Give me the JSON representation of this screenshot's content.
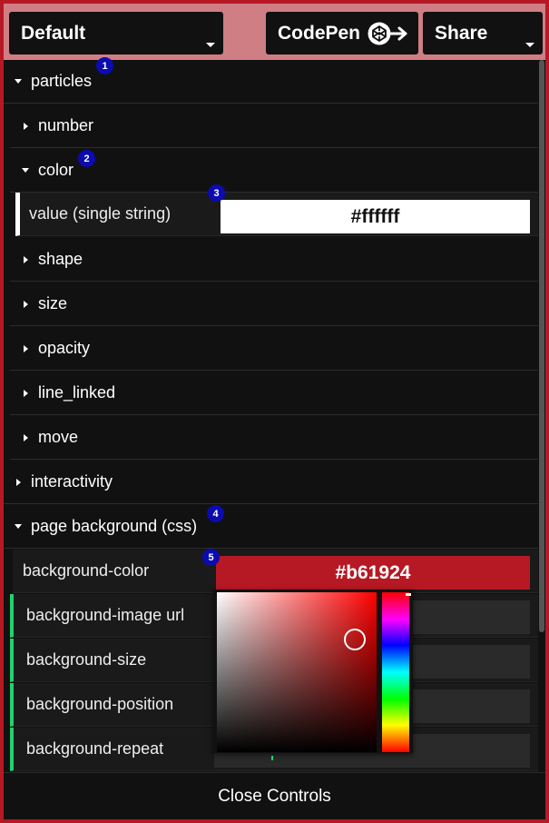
{
  "topbar": {
    "preset": "Default",
    "codepen_label": "CodePen",
    "share_label": "Share"
  },
  "markers": [
    "1",
    "2",
    "3",
    "4",
    "5"
  ],
  "tree": {
    "particles": "particles",
    "number": "number",
    "color": "color",
    "value_label": "value (single string)",
    "value": "#ffffff",
    "shape": "shape",
    "size": "size",
    "opacity": "opacity",
    "line_linked": "line_linked",
    "move": "move",
    "interactivity": "interactivity",
    "page_background": "page background (css)"
  },
  "background": {
    "color_label": "background-color",
    "color_value": "#b61924",
    "image_label": "background-image url",
    "size_label": "background-size",
    "position_label": "background-position",
    "repeat_label": "background-repeat"
  },
  "picker": {
    "hue_color": "#ff0000",
    "selected_color": "#b61924"
  },
  "footer": {
    "close_label": "Close Controls"
  },
  "colors": {
    "page_bg": "#b61924",
    "panel_bg": "#111111",
    "marker": "#0b0bb0",
    "accent_white": "#ffffff",
    "accent_green": "#1ed36f"
  }
}
